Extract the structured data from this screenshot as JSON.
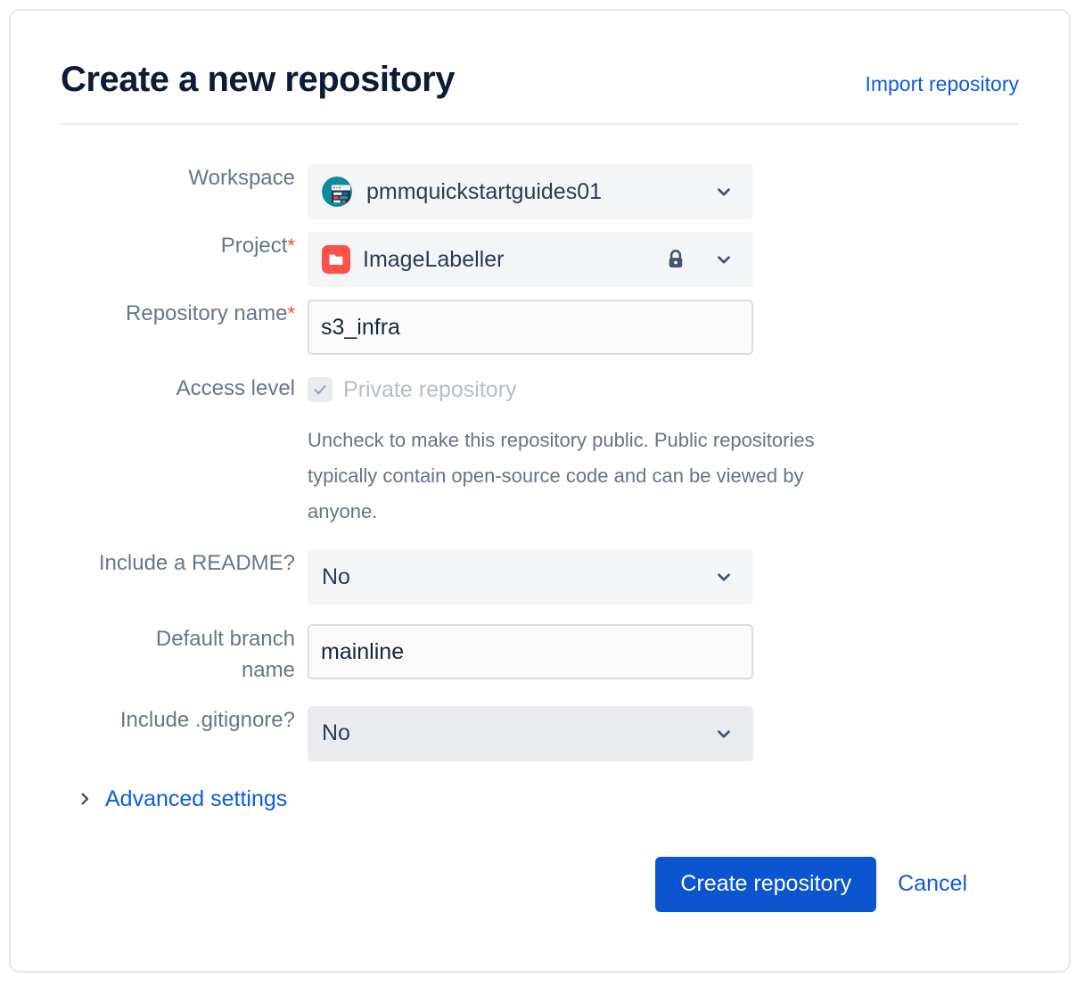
{
  "header": {
    "title": "Create a new repository",
    "import_link": "Import repository"
  },
  "form": {
    "workspace": {
      "label": "Workspace",
      "value": "pmmquickstartguides01",
      "avatar_icon": "workspace-avatar-icon",
      "chevron_icon": "chevron-down-icon"
    },
    "project": {
      "label": "Project",
      "required_marker": "*",
      "value": "ImageLabeller",
      "project_icon": "folder-icon",
      "lock_icon": "lock-icon",
      "chevron_icon": "chevron-down-icon"
    },
    "repository_name": {
      "label": "Repository name",
      "required_marker": "*",
      "value": "s3_infra",
      "placeholder": ""
    },
    "access_level": {
      "label": "Access level",
      "checkbox_label": "Private repository",
      "checked": true,
      "check_icon": "checkmark-icon",
      "helper_line1": "Uncheck to make this repository public. Public repositories",
      "helper_line2": "typically contain open-source code and can be viewed by",
      "helper_line3": "anyone."
    },
    "include_readme": {
      "label": "Include a README?",
      "value": "No",
      "chevron_icon": "chevron-down-icon"
    },
    "default_branch": {
      "label_line1": "Default branch",
      "label_line2": "name",
      "value": "mainline",
      "placeholder": ""
    },
    "include_gitignore": {
      "label": "Include .gitignore?",
      "value": "No",
      "chevron_icon": "chevron-down-icon"
    },
    "advanced_settings": {
      "label": "Advanced settings",
      "chevron_icon": "chevron-right-icon"
    }
  },
  "footer": {
    "submit_label": "Create repository",
    "cancel_label": "Cancel"
  },
  "colors": {
    "accent_blue": "#0c5ce0",
    "primary_button": "#0b55d0",
    "required_asterisk": "#e8502a",
    "label_text": "#67758d",
    "title_text": "#0c1b36",
    "field_background": "#f4f5f7",
    "project_icon": "#fd5249",
    "avatar_teal": "#0d8a9e"
  }
}
